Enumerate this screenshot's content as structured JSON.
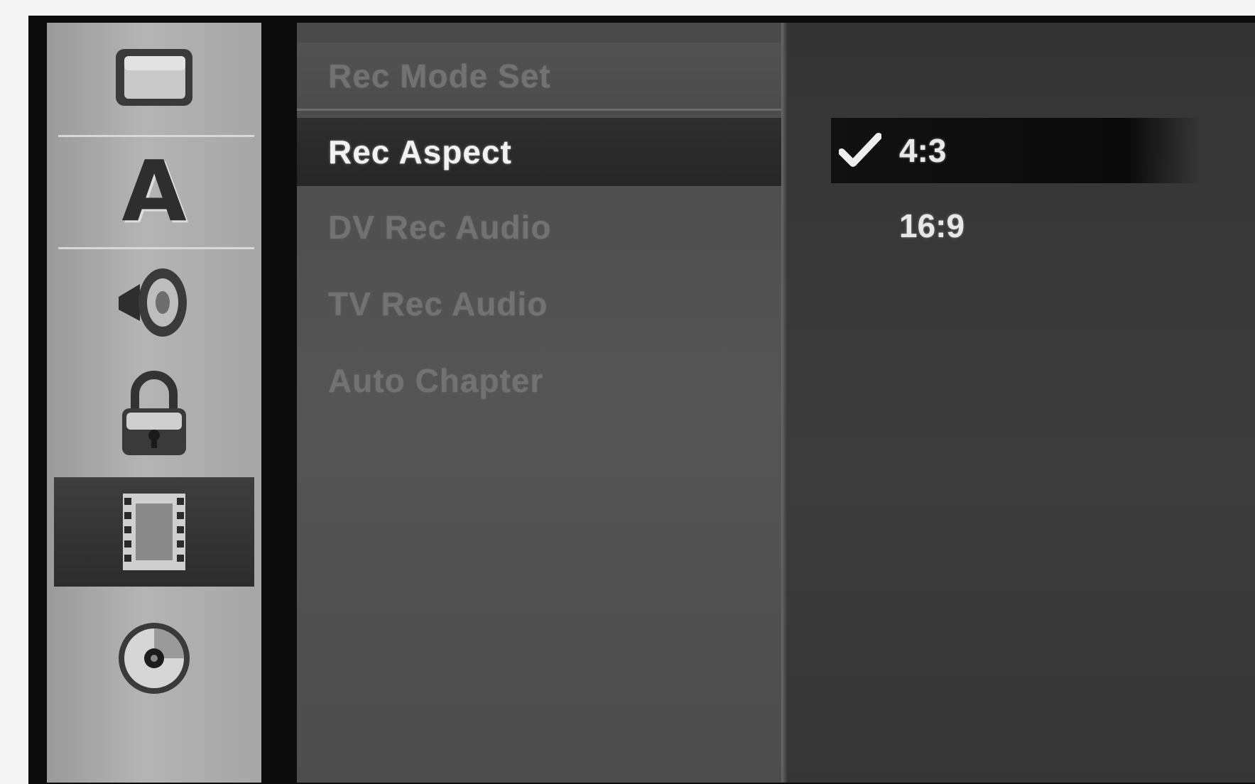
{
  "sidebar": {
    "icons": [
      {
        "name": "tv-screen-icon",
        "active": false
      },
      {
        "name": "language-a-icon",
        "active": false,
        "glyph": "A"
      },
      {
        "name": "speaker-icon",
        "active": false
      },
      {
        "name": "padlock-icon",
        "active": false
      },
      {
        "name": "film-strip-icon",
        "active": true
      },
      {
        "name": "disc-icon",
        "active": false
      }
    ]
  },
  "menu": {
    "items": [
      {
        "label": "Rec Mode Set",
        "state": "disabled"
      },
      {
        "label": "Rec Aspect",
        "state": "selected"
      },
      {
        "label": "DV Rec Audio",
        "state": "disabled"
      },
      {
        "label": "TV Rec Audio",
        "state": "disabled"
      },
      {
        "label": "Auto Chapter",
        "state": "disabled"
      }
    ]
  },
  "options": {
    "items": [
      {
        "label": "4:3",
        "checked": true
      },
      {
        "label": "16:9",
        "checked": false
      }
    ],
    "check_glyph": "✔"
  },
  "colors": {
    "sidebar_bg": "#aaaaaa",
    "menu_bg": "#4f4f4f",
    "options_bg": "#383838",
    "selected_bg": "#111111",
    "text_active": "#f2f2f2",
    "text_disabled": "#727272"
  }
}
